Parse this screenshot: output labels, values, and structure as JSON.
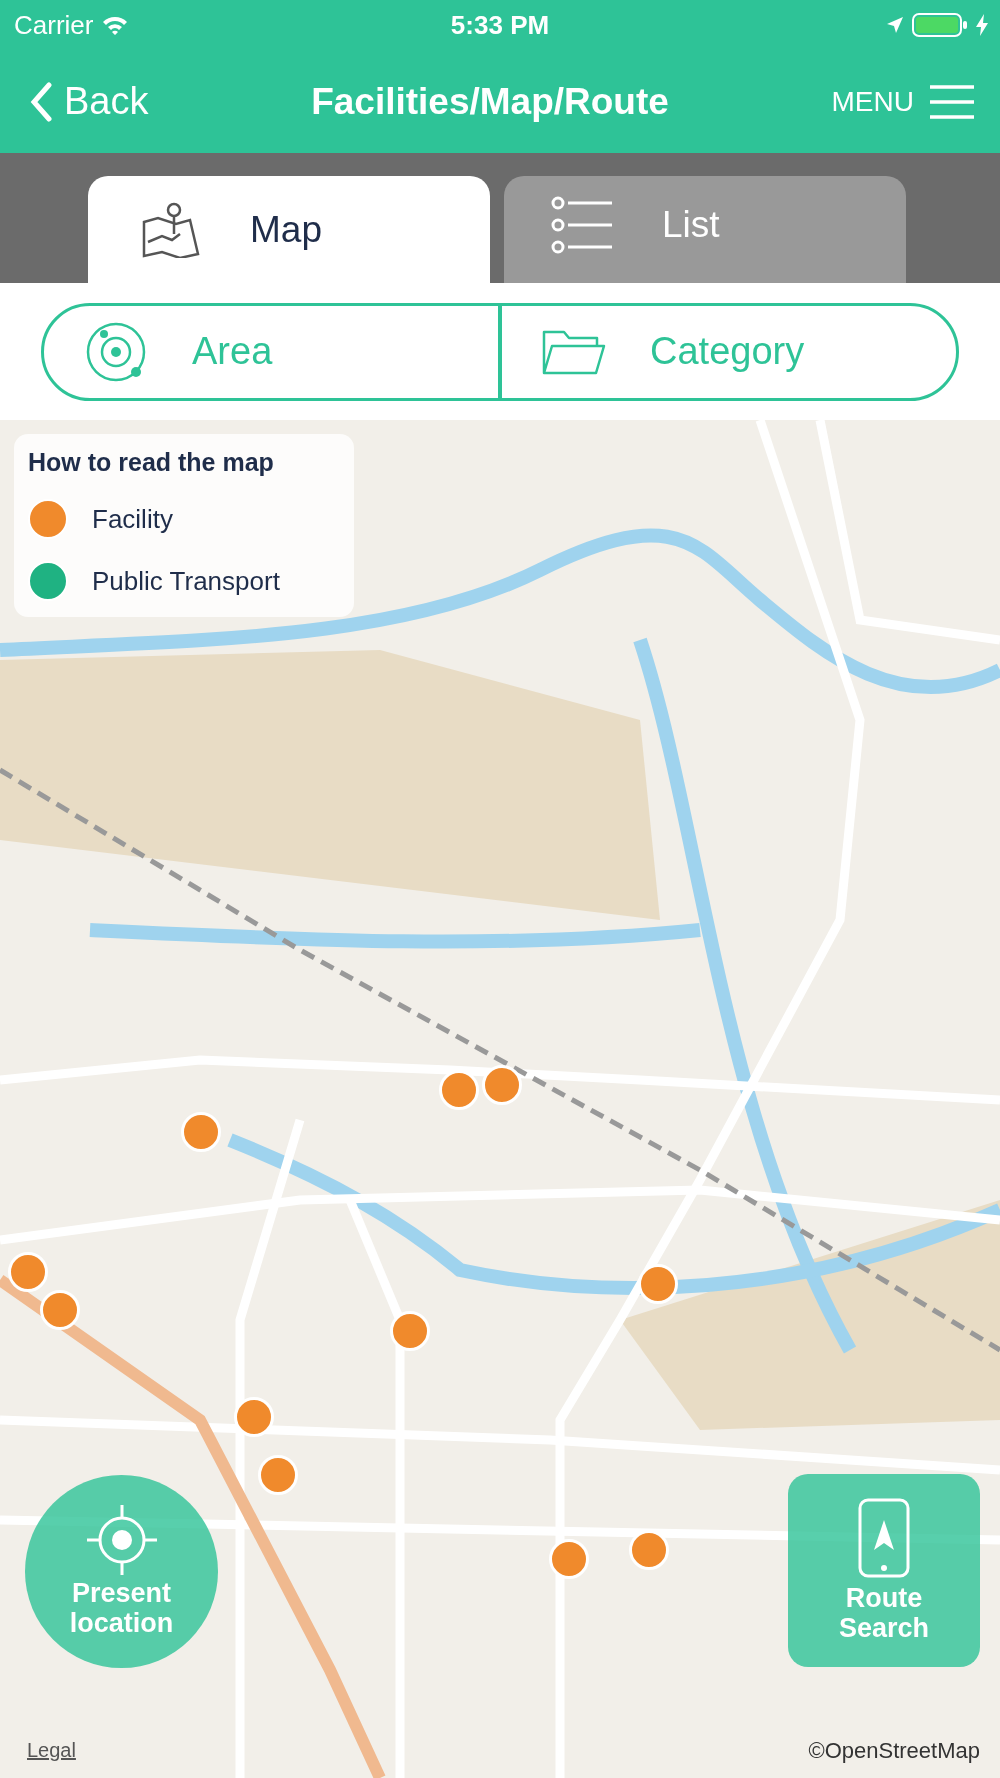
{
  "status_bar": {
    "carrier": "Carrier",
    "time": "5:33 PM"
  },
  "header": {
    "back": "Back",
    "title": "Facilities/Map/Route",
    "menu": "MENU"
  },
  "tabs": [
    {
      "label": "Map",
      "selected": true
    },
    {
      "label": "List",
      "selected": false
    }
  ],
  "filters": [
    "Area",
    "Category"
  ],
  "legend": {
    "title": "How to read the map",
    "items": [
      {
        "label": "Facility",
        "color": "#f08a2c"
      },
      {
        "label": "Public Transport",
        "color": "#1fb282"
      }
    ]
  },
  "present_location": "Present location",
  "route_search": "Route Search",
  "legal": "Legal",
  "attribution": "©OpenStreetMap"
}
